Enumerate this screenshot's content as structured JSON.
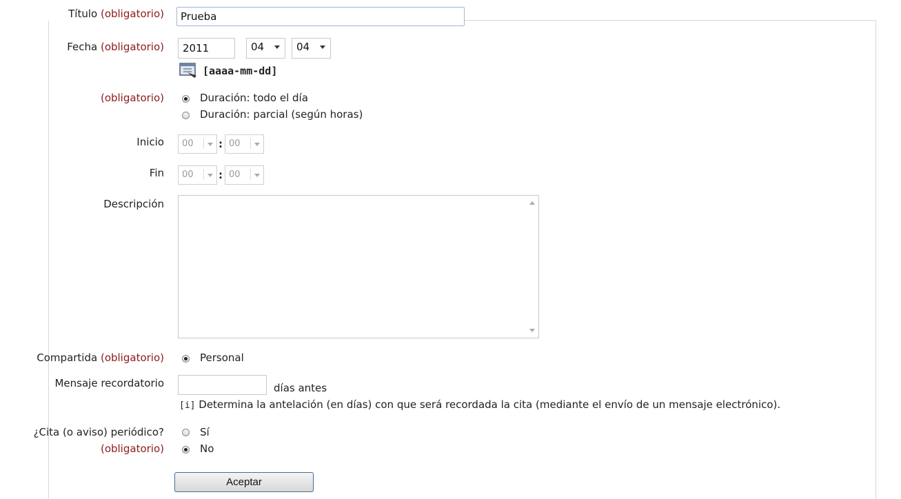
{
  "form": {
    "required_marker": "(obligatorio)",
    "title": {
      "label": "Título",
      "value": "Prueba"
    },
    "date": {
      "label": "Fecha",
      "year": "2011",
      "month": "04",
      "day": "04",
      "format_hint": "[aaaa-mm-dd]",
      "calendar_icon": "calendar-icon"
    },
    "duration": {
      "options": [
        {
          "label": "Duración: todo el día",
          "checked": true
        },
        {
          "label": "Duración: parcial (según horas)",
          "checked": false
        }
      ]
    },
    "start": {
      "label": "Inicio",
      "hour": "00",
      "minute": "00",
      "separator": ":"
    },
    "end": {
      "label": "Fin",
      "hour": "00",
      "minute": "00",
      "separator": ":"
    },
    "description": {
      "label": "Descripción",
      "value": ""
    },
    "shared": {
      "label": "Compartida",
      "option": "Personal",
      "checked": true
    },
    "reminder": {
      "label": "Mensaje recordatorio",
      "value": "",
      "suffix": "días antes",
      "info_marker": "[i]",
      "info": "Determina la antelación (en días) con que será recordada la cita (mediante el envío de un mensaje electrónico)."
    },
    "periodic": {
      "label": "¿Cita (o aviso) periódico?",
      "options": [
        {
          "label": "Sí",
          "checked": false
        },
        {
          "label": "No",
          "checked": true
        }
      ]
    },
    "submit_label": "Aceptar"
  },
  "colors": {
    "required": "#8b1a1a",
    "button_border": "#3f6fa0",
    "input_border": "#9fb8cf"
  }
}
